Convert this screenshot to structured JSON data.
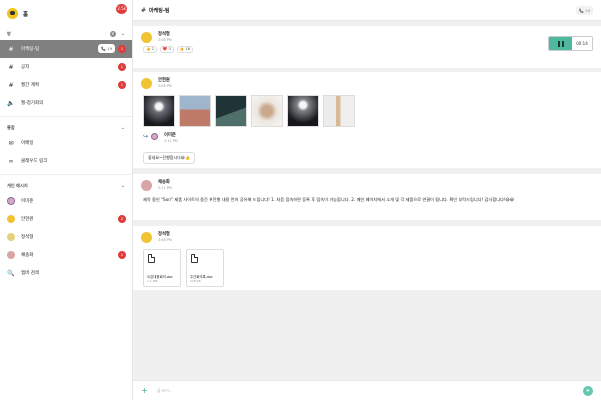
{
  "workspace": {
    "name": "홈",
    "badge": "2.5k"
  },
  "sidebar": {
    "sections": {
      "rooms": "방",
      "integrations": "통합",
      "direct": "개인 메시지"
    },
    "rooms": [
      {
        "label": "마케팅-팀",
        "active": true,
        "call": "19",
        "badge": "1"
      },
      {
        "label": "공지",
        "badge": "1"
      },
      {
        "label": "월간 계획",
        "badge": "1"
      },
      {
        "label": "월-정기회의"
      }
    ],
    "integrations": [
      {
        "label": "이메일",
        "icon": "mail-icon"
      },
      {
        "label": "클래우드 링크",
        "icon": "link-icon"
      }
    ],
    "direct": [
      {
        "label": "이미준"
      },
      {
        "label": "안현원",
        "badge": "2"
      },
      {
        "label": "정석형"
      },
      {
        "label": "채송화",
        "badge": "1"
      }
    ],
    "search_label": "멤버 검색"
  },
  "topbar": {
    "title": "마케팅-팀",
    "call": "19"
  },
  "messages": {
    "m1": {
      "user": "정석형",
      "time": "2:08 PM",
      "voice_time": "00:14",
      "reactions": [
        "👍 2",
        "❤️ 3",
        "👍 18"
      ]
    },
    "m2": {
      "user": "안현원",
      "time": "2:08 PM",
      "reply_user": "이미준",
      "reply_time": "2:11 PM",
      "reply_text": "좋네요~진행합시다😀👍"
    },
    "m3": {
      "user": "채송화",
      "time": "3:11 PM",
      "text": "제작 중인 \"Sori\" 제품 사이트의 중간 #진행 내용 먼저 공유해 드립니다! 1. 처음 접속하면 등록 후 접속이 가능합니다. 2. 메인 페이지에서 소개 및 각 제품으로 연결이 됩니다. 확인 부탁드립니다! 감사합니다!😀😀"
    },
    "m4": {
      "user": "정석형",
      "time": "3:46 PM",
      "files": [
        {
          "name": "오픈대응회의.doc",
          "size": "1.1 MB"
        },
        {
          "name": "주간회의록.doc",
          "size": "128 KB"
        }
      ]
    }
  },
  "input": {
    "placeholder": "글 쓰기..."
  }
}
